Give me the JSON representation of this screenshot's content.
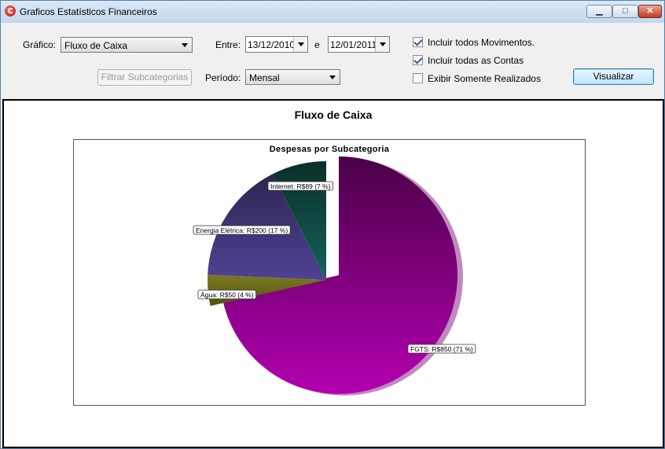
{
  "window": {
    "title": "Graficos Estatísticos Financeiros",
    "controls": [
      "▁",
      "□",
      "✕"
    ]
  },
  "form": {
    "grafico_label": "Gráfico:",
    "grafico_value": "Fluxo de Caixa",
    "entre_label": "Entre:",
    "date_from": "13/12/2010",
    "e_label": "e",
    "date_to": "12/01/2011",
    "filtrar_button": "Filtrar Subcategorias",
    "periodo_label": "Período:",
    "periodo_value": "Mensal",
    "checkboxes": [
      {
        "label": "Incluir todos Movimentos.",
        "checked": true
      },
      {
        "label": "Incluir todas as Contas",
        "checked": true
      },
      {
        "label": "Exibir Somente Realizados",
        "checked": false
      }
    ],
    "visualizar_button": "Visualizar"
  },
  "chart_data": {
    "type": "pie",
    "title": "Fluxo de Caixa",
    "subtitle": "Despesas por Subcategoria",
    "slices": [
      {
        "label": "FGTS: R$850 (71 %)",
        "value": 850,
        "color": "#800080"
      },
      {
        "label": "Água: R$50 (4 %)",
        "value": 50,
        "color": "#6e6a1e"
      },
      {
        "label": "Energia Elétrica: R$200 (17 %)",
        "value": 200,
        "color": "#4a3a82"
      },
      {
        "label": "Internet: R$89 (7 %)",
        "value": 89,
        "color": "#0f4a42"
      }
    ]
  }
}
